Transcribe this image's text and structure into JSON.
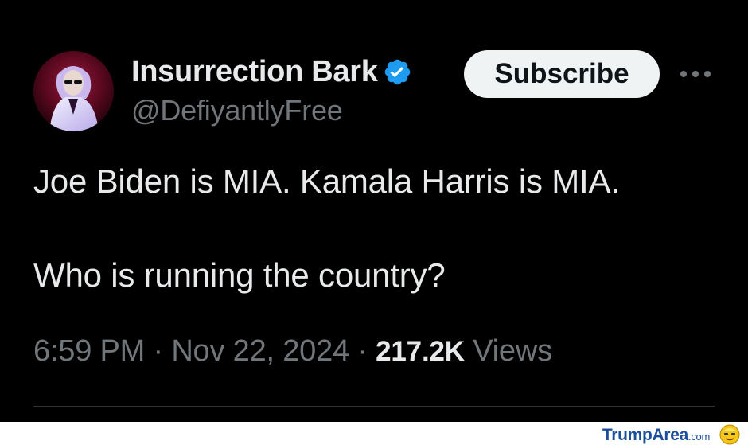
{
  "author": {
    "display_name": "Insurrection Bark",
    "handle": "@DefiyantlyFree",
    "avatar_icon": "profile-photo-avatar",
    "verified_icon": "verified-badge-icon"
  },
  "actions": {
    "subscribe_label": "Subscribe",
    "more_icon": "more-horizontal-icon"
  },
  "tweet": {
    "lines": [
      "Joe Biden is MIA. Kamala Harris is MIA.",
      "Who is running the country?"
    ],
    "time": "6:59 PM",
    "separator": "·",
    "date": "Nov 22, 2024",
    "views_count": "217.2K",
    "views_label": "Views"
  },
  "watermark": {
    "brand": "TrumpArea",
    "tld": ".com"
  },
  "colors": {
    "background": "#000000",
    "text_primary": "#e7e9ea",
    "text_secondary": "#71767b",
    "verified_blue": "#1d9bf0",
    "button_bg": "#eff3f4",
    "divider": "#2f3336",
    "watermark_blue": "#1b4f9c"
  }
}
